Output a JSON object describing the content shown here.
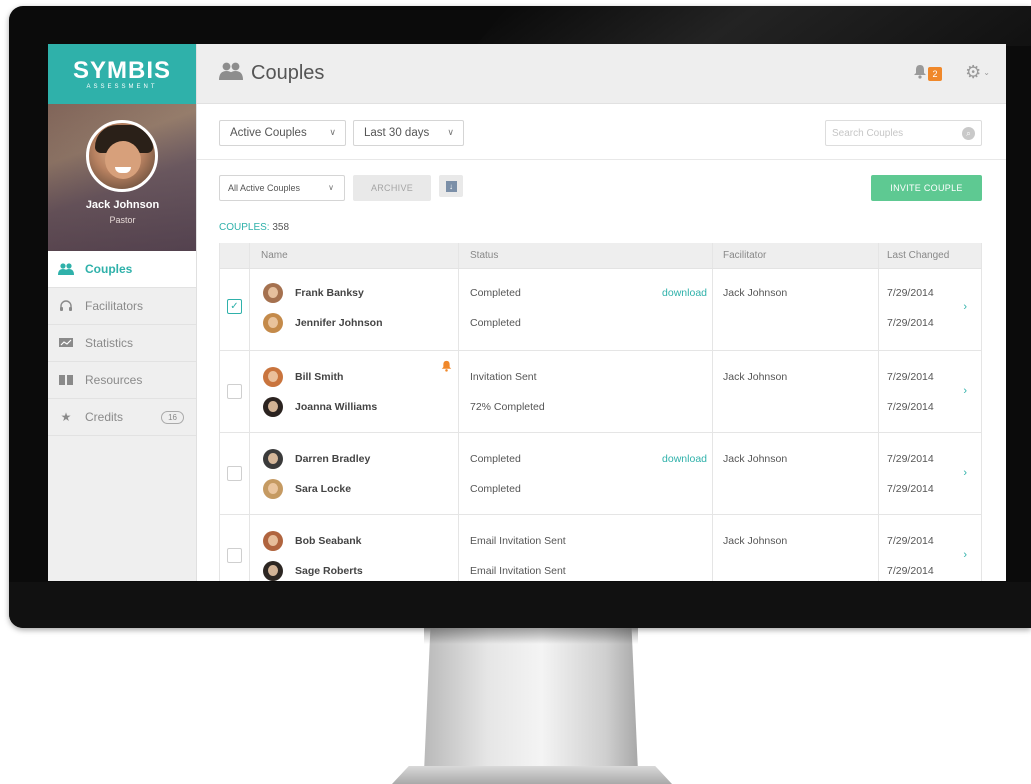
{
  "sidebar": {
    "logo": "SYMBIS",
    "logo_sub": "ASSESSMENT",
    "profile_name": "Jack Johnson",
    "profile_role": "Pastor",
    "nav": [
      {
        "label": "Couples",
        "icon": "couples-icon",
        "active": true
      },
      {
        "label": "Facilitators",
        "icon": "headset-icon"
      },
      {
        "label": "Statistics",
        "icon": "chart-icon"
      },
      {
        "label": "Resources",
        "icon": "book-icon"
      },
      {
        "label": "Credits",
        "icon": "star-icon",
        "badge": "16"
      }
    ]
  },
  "header": {
    "title": "Couples",
    "notification_count": "2"
  },
  "filters": {
    "status_select": "Active Couples",
    "period_select": "Last 30 days",
    "search_placeholder": "Search Couples"
  },
  "actions": {
    "list_select": "All Active Couples",
    "archive_label": "ARCHIVE",
    "invite_label": "INVITE COUPLE",
    "count_label": "COUPLES: ",
    "count_value": "358"
  },
  "table": {
    "columns": [
      "Name",
      "Status",
      "Facilitator",
      "Last Changed"
    ],
    "rows": [
      {
        "checked": true,
        "alert": false,
        "person1": "Frank Banksy",
        "person2": "Jennifer Johnson",
        "status1": "Completed",
        "status2": "Completed",
        "download": "download",
        "facilitator": "Jack Johnson",
        "date1": "7/29/2014",
        "date2": "7/29/2014"
      },
      {
        "checked": false,
        "alert": true,
        "person1": "Bill Smith",
        "person2": "Joanna Williams",
        "status1": "Invitation Sent",
        "status2": "72% Completed",
        "download": "",
        "facilitator": "Jack Johnson",
        "date1": "7/29/2014",
        "date2": "7/29/2014"
      },
      {
        "checked": false,
        "alert": false,
        "person1": "Darren Bradley",
        "person2": "Sara Locke",
        "status1": "Completed",
        "status2": "Completed",
        "download": "download",
        "facilitator": "Jack Johnson",
        "date1": "7/29/2014",
        "date2": "7/29/2014"
      },
      {
        "checked": false,
        "alert": false,
        "person1": "Bob Seabank",
        "person2": "Sage Roberts",
        "status1": "Email Invitation Sent",
        "status2": "Email Invitation Sent",
        "download": "",
        "facilitator": "Jack Johnson",
        "date1": "7/29/2014",
        "date2": "7/29/2014"
      }
    ]
  },
  "colors": {
    "accent": "#2fb1aa",
    "invite": "#5ec992",
    "notification": "#f0882a"
  }
}
